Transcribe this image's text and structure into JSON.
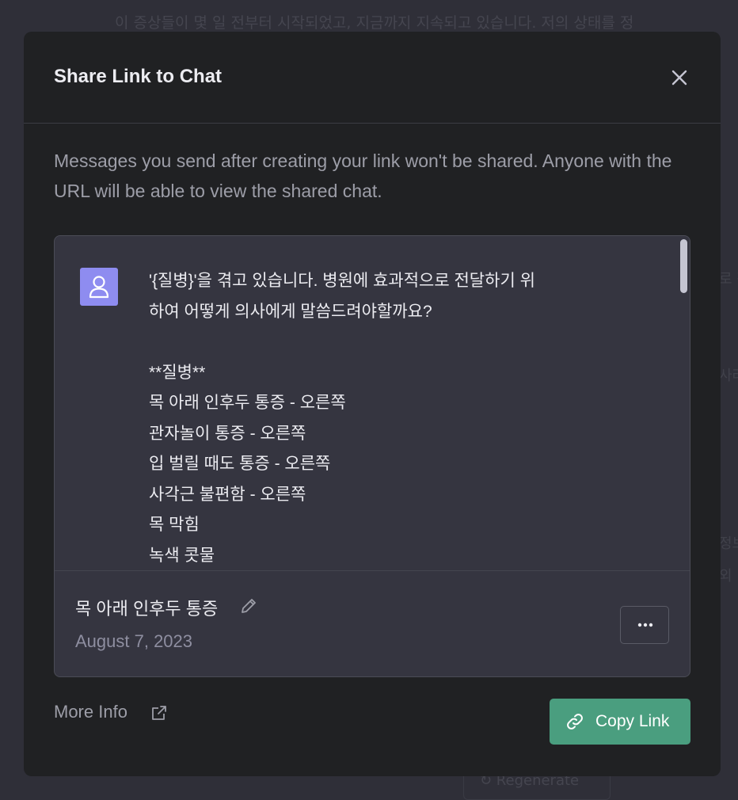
{
  "background": {
    "top_text": "이 증상들이 몇 일 전부터 시작되었고, 지금까지 지속되고 있습니다. 저의 상태를 정",
    "side_fragments": [
      "로 전",
      "사라",
      "정보",
      "외"
    ],
    "regenerate_label": "↻ Regenerate"
  },
  "modal": {
    "title": "Share Link to Chat",
    "close_icon": "close-icon",
    "description": "Messages you send after creating your link won't be shared. Anyone with the URL will be able to view the shared chat."
  },
  "preview": {
    "avatar_icon": "user-icon",
    "avatar_color": "#8e8cf0",
    "message_lines": [
      "'{질병}'을 겪고 있습니다. 병원에 효과적으로 전달하기 위",
      "하여 어떻게 의사에게 말씀드려야할까요?",
      "",
      "**질병**",
      "목 아래 인후두 통증 - 오른쪽",
      "관자놀이 통증 - 오른쪽",
      "입 벌릴 때도 통증 - 오른쪽",
      "사각근 불편함 - 오른쪽",
      "목 막힘",
      "녹색 콧물"
    ],
    "chat_title": "목 아래 인후두 통증",
    "chat_date": "August 7, 2023",
    "edit_icon": "pencil-icon",
    "more_icon": "ellipsis-icon"
  },
  "footer": {
    "more_info_label": "More Info",
    "more_info_icon": "external-link-icon",
    "copy_link_label": "Copy Link",
    "copy_link_icon": "link-icon",
    "accent_color": "#4a9e7f"
  }
}
